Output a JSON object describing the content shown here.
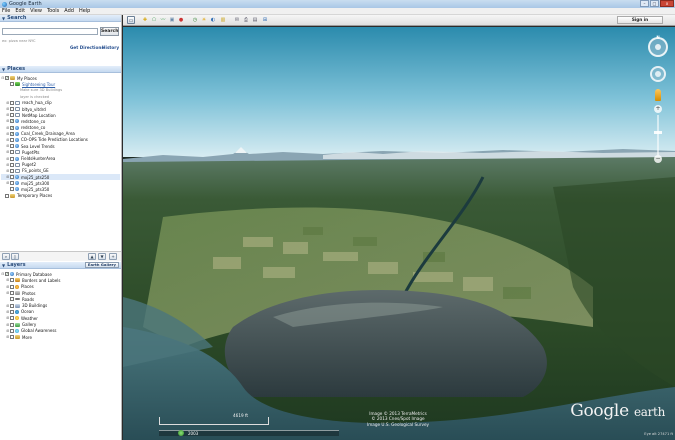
{
  "window": {
    "title": "Google Earth"
  },
  "menu": [
    "File",
    "Edit",
    "View",
    "Tools",
    "Add",
    "Help"
  ],
  "search": {
    "header": "Search",
    "placeholder": "",
    "button": "Search",
    "hint": "ex: pizza near NYC",
    "get_directions": "Get Directions",
    "history": "History"
  },
  "places": {
    "header": "Places",
    "items": [
      {
        "label": "My Places",
        "level": 0,
        "icon": "folder",
        "checked": true,
        "expand": "-"
      },
      {
        "label": "Sightseeing Tour",
        "level": 1,
        "icon": "tour",
        "checked": false,
        "link": true
      },
      {
        "label": "Make sure 3D Buildings",
        "level": 2,
        "sub": true
      },
      {
        "label": "layer is checked",
        "level": 2,
        "sub": true
      },
      {
        "label": "reach_hua_clip",
        "level": 1,
        "icon": "doc",
        "checked": false,
        "expand": "+"
      },
      {
        "label": "bltyo_vitdrd",
        "level": 1,
        "icon": "doc",
        "checked": false,
        "expand": "+"
      },
      {
        "label": "NetMap Location",
        "level": 1,
        "icon": "doc",
        "checked": false,
        "expand": "+"
      },
      {
        "label": "redstone_co",
        "level": 1,
        "icon": "globe",
        "checked": true,
        "expand": "+"
      },
      {
        "label": "redstone_co",
        "level": 1,
        "icon": "globe",
        "checked": true,
        "expand": "+"
      },
      {
        "label": "Coal_Creek_Drainage_Area",
        "level": 1,
        "icon": "globe",
        "checked": true,
        "expand": "+"
      },
      {
        "label": "CO-OPS Tide Prediction Locations",
        "level": 1,
        "icon": "globe",
        "checked": false,
        "expand": "+"
      },
      {
        "label": "Sea Level Trends",
        "level": 1,
        "icon": "globe",
        "checked": false,
        "expand": "+"
      },
      {
        "label": "PugetPts",
        "level": 1,
        "icon": "doc",
        "checked": false,
        "expand": "+"
      },
      {
        "label": "FieldsHunterArea",
        "level": 1,
        "icon": "globe",
        "checked": false,
        "expand": "+"
      },
      {
        "label": "Puget2",
        "level": 1,
        "icon": "doc",
        "checked": false,
        "expand": "+"
      },
      {
        "label": "FS_points_GE",
        "level": 1,
        "icon": "doc",
        "checked": false,
        "expand": "+"
      },
      {
        "label": "mxj25_pts250",
        "level": 1,
        "icon": "globe",
        "checked": false,
        "expand": "+",
        "selected": true
      },
      {
        "label": "mxj25_pts300",
        "level": 1,
        "icon": "globe",
        "checked": false,
        "expand": "+"
      },
      {
        "label": "mxj25_pts350",
        "level": 1,
        "icon": "globe",
        "checked": false,
        "expand": ""
      },
      {
        "label": "Temporary Places",
        "level": 0,
        "icon": "folder",
        "checked": false,
        "expand": ""
      }
    ]
  },
  "layers": {
    "header": "Layers",
    "earth_gallery": "Earth Gallery",
    "items": [
      {
        "label": "Primary Database",
        "level": 0,
        "icon": "globe",
        "checked": true,
        "expand": "-"
      },
      {
        "label": "Borders and Labels",
        "level": 1,
        "icon": "border",
        "checked": false,
        "expand": "+"
      },
      {
        "label": "Places",
        "level": 1,
        "icon": "pin",
        "checked": false,
        "expand": "+"
      },
      {
        "label": "Photos",
        "level": 1,
        "icon": "photo",
        "checked": false,
        "expand": "+"
      },
      {
        "label": "Roads",
        "level": 1,
        "icon": "road",
        "checked": false,
        "expand": ""
      },
      {
        "label": "3D Buildings",
        "level": 1,
        "icon": "3d",
        "checked": false,
        "expand": "+"
      },
      {
        "label": "Ocean",
        "level": 1,
        "icon": "ocean",
        "checked": false,
        "expand": "+"
      },
      {
        "label": "Weather",
        "level": 1,
        "icon": "weather",
        "checked": false,
        "expand": "+"
      },
      {
        "label": "Gallery",
        "level": 1,
        "icon": "gallery",
        "checked": false,
        "expand": "+"
      },
      {
        "label": "Global Awareness",
        "level": 1,
        "icon": "aware",
        "checked": false,
        "expand": "+"
      },
      {
        "label": "More",
        "level": 1,
        "icon": "more",
        "checked": false,
        "expand": "+"
      }
    ]
  },
  "toolbar": {
    "sign_in": "Sign in",
    "icons": [
      "sidebar-toggle-icon",
      "placemark-icon",
      "polygon-icon",
      "path-icon",
      "image-overlay-icon",
      "record-tour-icon",
      "historical-imagery-icon",
      "sun-icon",
      "planets-icon",
      "ruler-icon",
      "email-icon",
      "print-icon",
      "save-image-icon",
      "maps-icon"
    ]
  },
  "viewport": {
    "scale_label": "4619 ft",
    "time_label": "2003",
    "credits": [
      "Image © 2013 TerraMetrics",
      "© 2013 Cnes/Spot Image",
      "Image U.S. Geological Survey"
    ],
    "logo_main": "Google",
    "logo_sub": "earth",
    "eye_alt": "Eye alt 27471 ft",
    "compass_n": "N"
  },
  "colors": {
    "sky_top": "#2c8fb1",
    "sky_horizon": "#c7e3ec",
    "forest": "#2f4d2b",
    "water": "#3f6b74",
    "link": "#2c5da8"
  }
}
